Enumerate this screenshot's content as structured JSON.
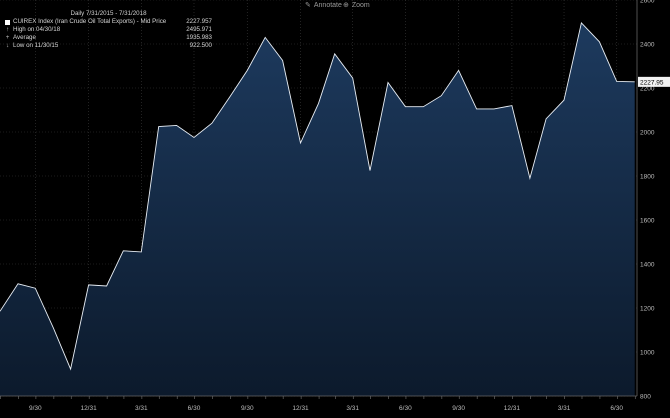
{
  "toolbar": {
    "annotate_label": "Annotate",
    "zoom_label": "Zoom"
  },
  "legend": {
    "period": "Daily 7/31/2015 - 7/31/2018",
    "series_label": "CUIREX Index (Iran Crude Oil Total Exports) - Mid Price",
    "series_value": "2227.957",
    "high_label": "High on 04/30/18",
    "high_value": "2495.971",
    "avg_label": "Average",
    "avg_value": "1935.983",
    "low_label": "Low on 11/30/15",
    "low_value": "922.500"
  },
  "last_price_tag": "2227.95",
  "colors": {
    "background": "#000000",
    "area_top": "#1d3a5e",
    "area_bottom": "#0c1a2c",
    "line": "#e8eef5",
    "grid": "#3a3a3a"
  },
  "chart_data": {
    "type": "area",
    "series": [
      {
        "name": "CUIREX Index (Iran Crude Oil Total Exports)",
        "x": [
          "2015-07-31",
          "2015-08-31",
          "2015-09-30",
          "2015-10-31",
          "2015-11-30",
          "2015-12-31",
          "2016-01-31",
          "2016-02-29",
          "2016-03-31",
          "2016-04-30",
          "2016-05-31",
          "2016-06-30",
          "2016-07-31",
          "2016-08-31",
          "2016-09-30",
          "2016-10-31",
          "2016-11-30",
          "2016-12-31",
          "2017-01-31",
          "2017-02-28",
          "2017-03-31",
          "2017-04-30",
          "2017-05-31",
          "2017-06-30",
          "2017-07-31",
          "2017-08-31",
          "2017-09-30",
          "2017-10-31",
          "2017-11-30",
          "2017-12-31",
          "2018-01-31",
          "2018-02-28",
          "2018-03-31",
          "2018-04-30",
          "2018-05-31",
          "2018-06-30",
          "2018-07-31"
        ],
        "values": [
          1185,
          1310,
          1290,
          1110,
          922.5,
          1305,
          1300,
          1460,
          1455,
          2025,
          2030,
          1975,
          2040,
          2160,
          2280,
          2430,
          2325,
          1950,
          2130,
          2355,
          2245,
          1825,
          2225,
          2115,
          2115,
          2165,
          2280,
          2105,
          2105,
          2120,
          1790,
          2060,
          2145,
          2495.971,
          2410,
          2230,
          2227.957
        ]
      }
    ],
    "x_tick_labels": [
      "9/30",
      "12/31",
      "3/31",
      "6/30",
      "9/30",
      "12/31",
      "3/31",
      "6/30",
      "9/30",
      "12/31",
      "3/31",
      "6/30"
    ],
    "x_tick_dates": [
      "2015-09-30",
      "2015-12-31",
      "2016-03-31",
      "2016-06-30",
      "2016-09-30",
      "2016-12-31",
      "2017-03-31",
      "2017-06-30",
      "2017-09-30",
      "2017-12-31",
      "2018-03-31",
      "2018-06-30"
    ],
    "y_ticks": [
      800,
      1000,
      1200,
      1400,
      1600,
      1800,
      2000,
      2200,
      2400,
      2600
    ],
    "ylim": [
      800,
      2600
    ],
    "xlim": [
      "2015-07-31",
      "2018-08-04"
    ],
    "grid": true,
    "legend_position": "top-left"
  }
}
